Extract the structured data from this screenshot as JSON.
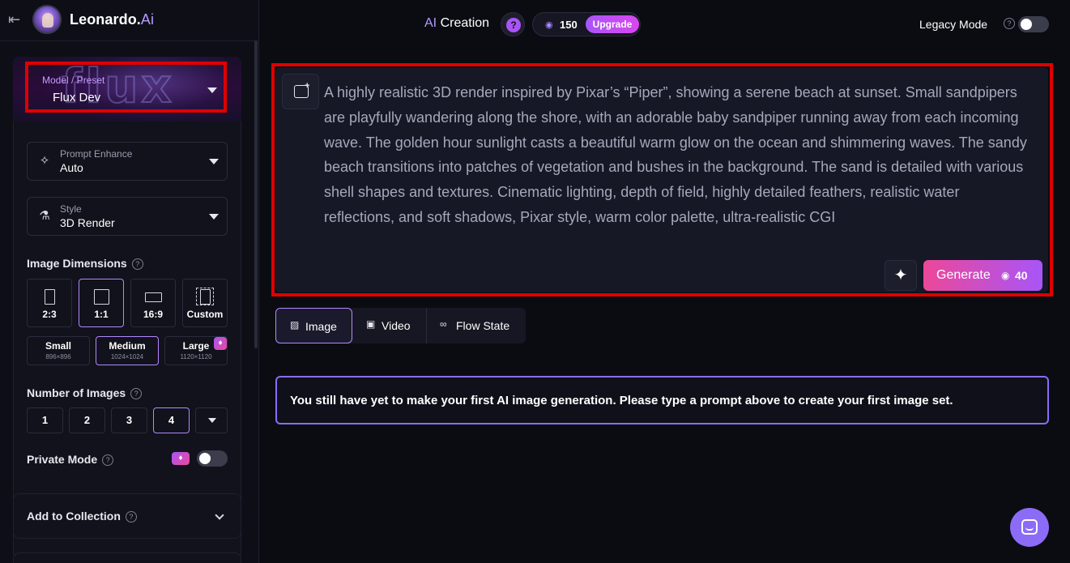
{
  "header": {
    "brand_main": "Leonardo.",
    "brand_ai": "Ai",
    "ai_creation_ai": "AI",
    "ai_creation_rest": " Creation",
    "help_glyph": "?",
    "token_count": "150",
    "upgrade_label": "Upgrade",
    "legacy_label": "Legacy Mode",
    "legacy_enabled": false
  },
  "sidebar": {
    "model": {
      "label": "Model / Preset",
      "value": "Flux Dev",
      "art_text": "flux"
    },
    "prompt_enhance": {
      "label": "Prompt Enhance",
      "value": "Auto"
    },
    "style": {
      "label": "Style",
      "value": "3D Render"
    },
    "image_dimensions": {
      "title": "Image Dimensions",
      "ratios": [
        "2:3",
        "1:1",
        "16:9",
        "Custom"
      ],
      "selected_ratio": "1:1",
      "sizes": [
        {
          "name": "Small",
          "dims": "896×896"
        },
        {
          "name": "Medium",
          "dims": "1024×1024"
        },
        {
          "name": "Large",
          "dims": "1120×1120"
        }
      ],
      "selected_size": "Medium"
    },
    "number_of_images": {
      "title": "Number of Images",
      "options": [
        "1",
        "2",
        "3",
        "4"
      ],
      "selected": "4"
    },
    "private_mode": {
      "title": "Private Mode",
      "enabled": false
    },
    "add_to_collection": {
      "title": "Add to Collection"
    }
  },
  "prompt": {
    "text": "A highly realistic 3D render inspired by Pixar’s “Piper”, showing a serene beach at sunset. Small sandpipers are playfully wandering along the shore, with an adorable baby sandpiper running away from each incoming wave. The golden hour sunlight casts a beautiful warm glow on the ocean and shimmering waves. The sandy beach transitions into patches of vegetation and bushes in the background. The sand is detailed with various shell shapes and textures. Cinematic lighting, depth of field, highly detailed feathers, realistic water reflections, and soft shadows, Pixar style, warm color palette, ultra-realistic CGI",
    "generate_label": "Generate",
    "generate_cost": "40"
  },
  "tabs": [
    {
      "label": "Image",
      "active": true
    },
    {
      "label": "Video",
      "active": false
    },
    {
      "label": "Flow State",
      "active": false
    }
  ],
  "notice": "You still have yet to make your first AI image generation. Please type a prompt above to create your first image set.",
  "colors": {
    "accent_purple": "#b388ff",
    "highlight_red": "#e00000",
    "generate_gradient_start": "#ec4899",
    "generate_gradient_end": "#a855f7",
    "background": "#0b0c12"
  },
  "icons": {
    "back": "arrow-left-to-bar-icon",
    "enhance": "sparkles-icon",
    "style": "flask-icon",
    "premium": "gem-icon",
    "image_add": "image-plus-icon",
    "magic": "sparkles-icon",
    "coins": "coins-icon",
    "chat": "chat-bubble-icon"
  }
}
